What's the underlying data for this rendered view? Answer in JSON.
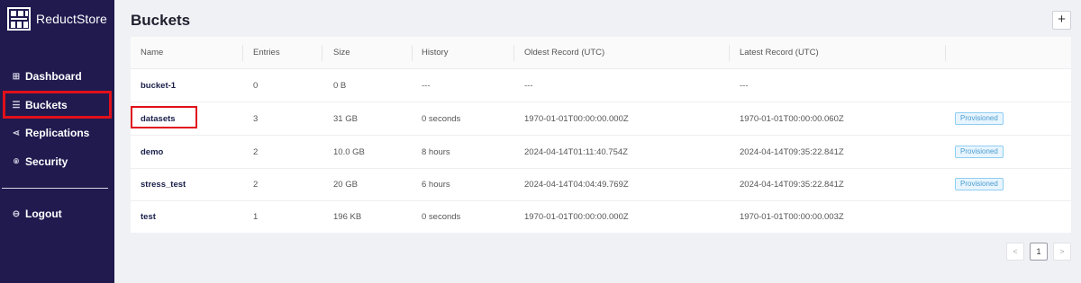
{
  "app": {
    "name": "ReductStore"
  },
  "sidebar": {
    "items": [
      {
        "label": "Dashboard",
        "icon": "dashboard-icon",
        "glyph": "⊞"
      },
      {
        "label": "Buckets",
        "icon": "buckets-icon",
        "glyph": "☰"
      },
      {
        "label": "Replications",
        "icon": "share-icon",
        "glyph": "⋖"
      },
      {
        "label": "Security",
        "icon": "lock-icon",
        "glyph": "⍟"
      }
    ],
    "logout": {
      "label": "Logout",
      "icon": "logout-icon",
      "glyph": "⊖"
    },
    "active_item": "Buckets"
  },
  "page": {
    "title": "Buckets",
    "add_label": "+"
  },
  "table": {
    "columns": [
      "Name",
      "Entries",
      "Size",
      "History",
      "Oldest Record (UTC)",
      "Latest Record (UTC)",
      ""
    ],
    "rows": [
      {
        "name": "bucket-1",
        "entries": "0",
        "size": "0 B",
        "history": "---",
        "oldest": "---",
        "latest": "---",
        "badge": ""
      },
      {
        "name": "datasets",
        "entries": "3",
        "size": "31 GB",
        "history": "0 seconds",
        "oldest": "1970-01-01T00:00:00.000Z",
        "latest": "1970-01-01T00:00:00.060Z",
        "badge": "Provisioned"
      },
      {
        "name": "demo",
        "entries": "2",
        "size": "10.0 GB",
        "history": "8 hours",
        "oldest": "2024-04-14T01:11:40.754Z",
        "latest": "2024-04-14T09:35:22.841Z",
        "badge": "Provisioned"
      },
      {
        "name": "stress_test",
        "entries": "2",
        "size": "20 GB",
        "history": "6 hours",
        "oldest": "2024-04-14T04:04:49.769Z",
        "latest": "2024-04-14T09:35:22.841Z",
        "badge": "Provisioned"
      },
      {
        "name": "test",
        "entries": "1",
        "size": "196 KB",
        "history": "0 seconds",
        "oldest": "1970-01-01T00:00:00.000Z",
        "latest": "1970-01-01T00:00:00.003Z",
        "badge": ""
      }
    ],
    "highlighted_row": "datasets"
  },
  "pagination": {
    "prev": "<",
    "current": "1",
    "next": ">"
  },
  "colors": {
    "sidebar": "#201a4f",
    "highlight": "#e0101a",
    "badge_text": "#4a9cd0",
    "background": "#f0f1f5"
  }
}
